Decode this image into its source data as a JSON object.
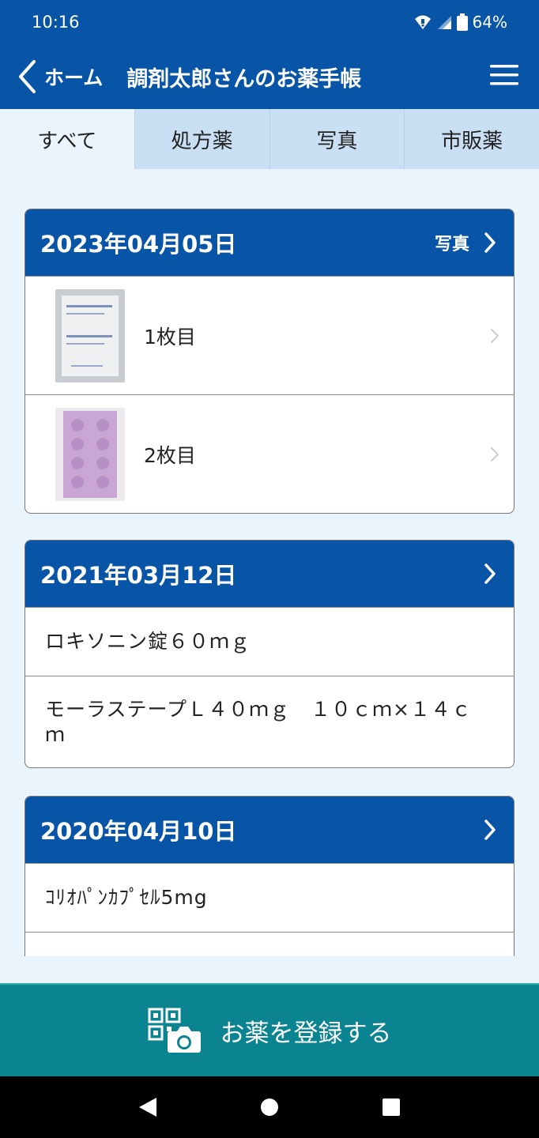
{
  "status": {
    "time": "10:16",
    "battery": "64%"
  },
  "header": {
    "back_label": "ホーム",
    "title": "調剤太郎さんのお薬手帳"
  },
  "tabs": [
    {
      "label": "すべて",
      "active": true
    },
    {
      "label": "処方薬",
      "active": false
    },
    {
      "label": "写真",
      "active": false
    },
    {
      "label": "市販薬",
      "active": false
    }
  ],
  "cards": [
    {
      "date": "2023年04月05日",
      "action_label": "写真",
      "photos": [
        {
          "label": "1枚目",
          "thumb_color": "#d8dde2"
        },
        {
          "label": "2枚目",
          "thumb_color": "#c9a6d6"
        }
      ]
    },
    {
      "date": "2021年03月12日",
      "items": [
        "ロキソニン錠６０ｍｇ",
        "モーラステープＬ４０ｍｇ　１０ｃｍ×１４ｃｍ"
      ]
    },
    {
      "date": "2020年04月10日",
      "items": [
        "ｺﾘｵﾊﾟﾝｶﾌﾟｾﾙ5mg",
        ""
      ]
    }
  ],
  "register_button": {
    "label": "お薬を登録する"
  },
  "colors": {
    "primary": "#0855a8",
    "register": "#0a8491",
    "background": "#eaf4fc"
  }
}
